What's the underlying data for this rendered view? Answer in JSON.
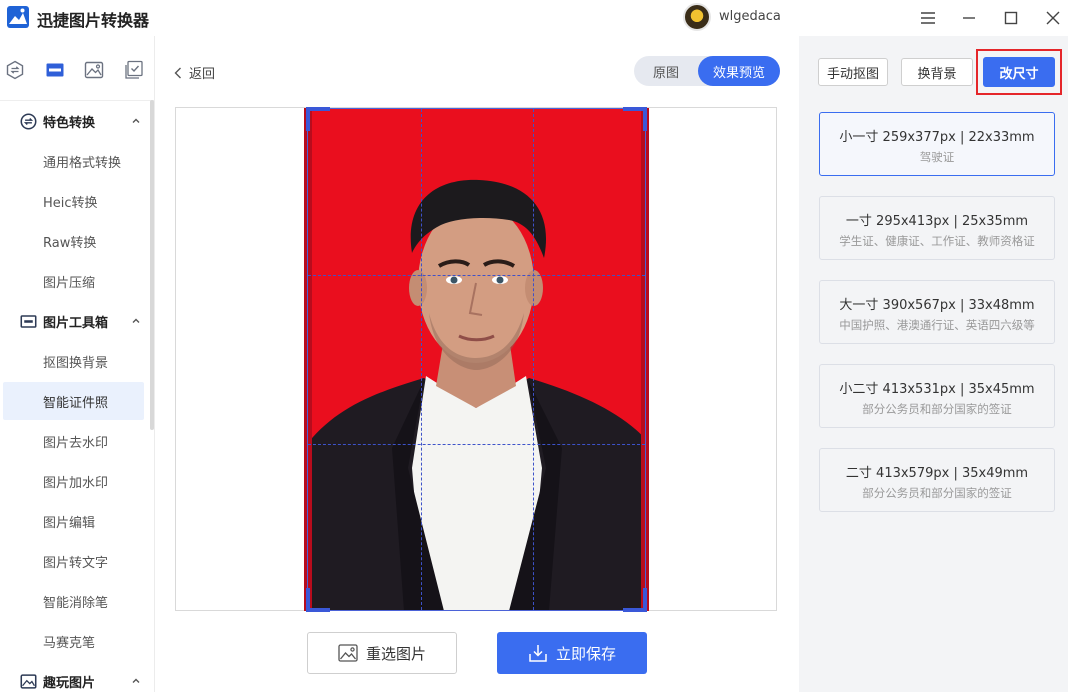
{
  "app": {
    "title": "迅捷图片转换器",
    "username": "wlgedaca"
  },
  "colors": {
    "accent": "#3a6df0",
    "photo_bg": "#ea0e1e",
    "highlight": "#e5262a"
  },
  "sidebar": {
    "top_icons": [
      "convert-icon",
      "toolbox-icon",
      "image-icon",
      "checkbox-icon"
    ],
    "sections": [
      {
        "label": "特色转换",
        "icon": "convert-icon",
        "items": [
          "通用格式转换",
          "Heic转换",
          "Raw转换",
          "图片压缩"
        ]
      },
      {
        "label": "图片工具箱",
        "icon": "toolbox-icon",
        "items": [
          "抠图换背景",
          "智能证件照",
          "图片去水印",
          "图片加水印",
          "图片编辑",
          "图片转文字",
          "智能消除笔",
          "马赛克笔"
        ],
        "active_item": "智能证件照"
      },
      {
        "label": "趣玩图片",
        "icon": "image-icon",
        "items": []
      }
    ]
  },
  "main": {
    "back_label": "返回",
    "view_toggle": {
      "original": "原图",
      "preview": "效果预览",
      "selected": "效果预览"
    },
    "reselect_label": "重选图片",
    "save_label": "立即保存"
  },
  "right_panel": {
    "tools": {
      "manual_cutout": "手动抠图",
      "change_bg": "换背景",
      "resize": "改尺寸",
      "selected": "改尺寸"
    },
    "sizes": [
      {
        "title": "小一寸 259x377px | 22x33mm",
        "sub": "驾驶证",
        "selected": true
      },
      {
        "title": "一寸 295x413px | 25x35mm",
        "sub": "学生证、健康证、工作证、教师资格证",
        "selected": false
      },
      {
        "title": "大一寸 390x567px | 33x48mm",
        "sub": "中国护照、港澳通行证、英语四六级等",
        "selected": false
      },
      {
        "title": "小二寸 413x531px | 35x45mm",
        "sub": "部分公务员和部分国家的签证",
        "selected": false
      },
      {
        "title": "二寸 413x579px | 35x49mm",
        "sub": "部分公务员和部分国家的签证",
        "selected": false
      }
    ]
  }
}
